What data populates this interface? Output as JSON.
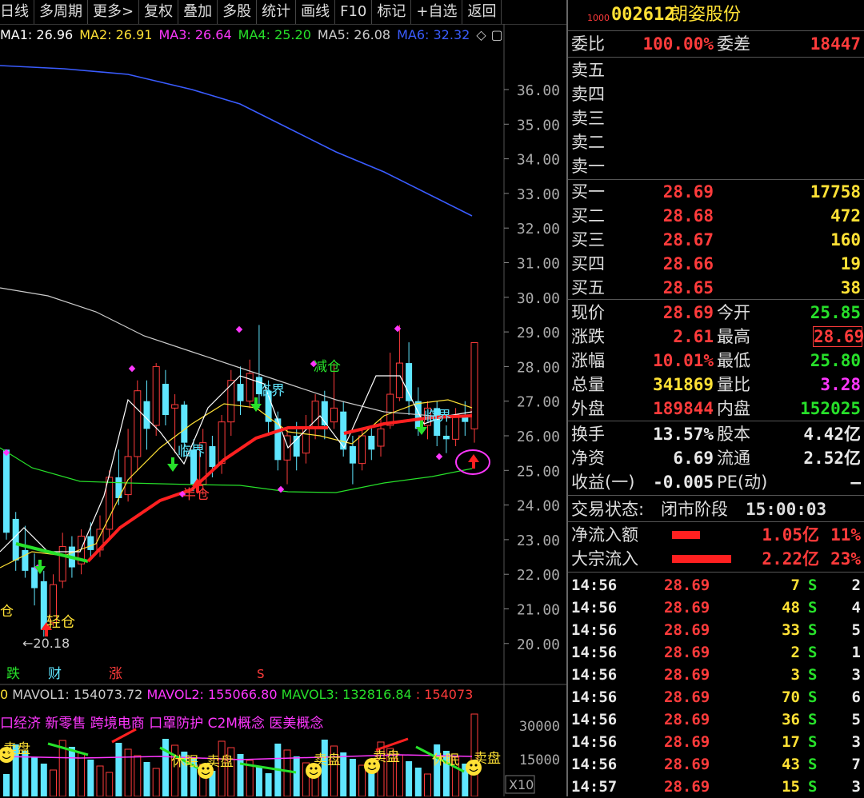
{
  "toolbar": {
    "items": [
      "日线",
      "多周期",
      "更多",
      "复权",
      "叠加",
      "多股",
      "统计",
      "画线",
      "F10",
      "标记",
      "+自选",
      "返回"
    ]
  },
  "ma_legend": [
    {
      "label": "MA1: 26.96",
      "color": "#ffffff"
    },
    {
      "label": "MA2: 26.91",
      "color": "#ffe135"
    },
    {
      "label": "MA3: 26.64",
      "color": "#ff37ff"
    },
    {
      "label": "MA4: 25.20",
      "color": "#27e02a"
    },
    {
      "label": "MA5: 26.08",
      "color": "#cccccc"
    },
    {
      "label": "MA6: 32.32",
      "color": "#3a5cff"
    }
  ],
  "price_axis": [
    "36.00",
    "35.00",
    "34.00",
    "33.00",
    "32.00",
    "31.00",
    "30.00",
    "29.00",
    "28.00",
    "27.00",
    "26.00",
    "25.00",
    "24.00",
    "23.00",
    "22.00",
    "21.00",
    "20.00"
  ],
  "chart_annotations": {
    "low_label": "←20.18",
    "light_position": "轻仓",
    "half_position": "半仓",
    "critical_1": "临界",
    "critical_2": "临界",
    "critical_3": "临界",
    "reduce_position": "减仓",
    "left_cut": "仓",
    "event_fall": "跌",
    "event_finance": "财",
    "event_rise": "涨",
    "event_s": "S"
  },
  "volume": {
    "legend_prefix": "0",
    "mavol1": "MAVOL1: 154073.72",
    "mavol2": "MAVOL2: 155066.80",
    "mavol3": "MAVOL3: 132816.84",
    "mavol4": ": 154073",
    "concepts": "口经济 新零售 跨境电商 口罩防护 C2M概念 医美概念",
    "axis": [
      "30000",
      "15000"
    ],
    "multiplier": "X10",
    "marker_labels": [
      "卖盘",
      "休眠",
      "卖盘",
      "卖盘",
      "卖盘",
      "休眠",
      "卖盘"
    ]
  },
  "stock": {
    "code_prefix": "1000",
    "code": "002612",
    "name": "朗姿股份"
  },
  "order_ratio": {
    "label": "委比",
    "value": "100.00%",
    "diff_label": "委差",
    "diff_value": "18447"
  },
  "sell": [
    "卖五",
    "卖四",
    "卖三",
    "卖二",
    "卖一"
  ],
  "buy": [
    {
      "label": "买一",
      "price": "28.69",
      "vol": "17758"
    },
    {
      "label": "买二",
      "price": "28.68",
      "vol": "472"
    },
    {
      "label": "买三",
      "price": "28.67",
      "vol": "160"
    },
    {
      "label": "买四",
      "price": "28.66",
      "vol": "19"
    },
    {
      "label": "买五",
      "price": "28.65",
      "vol": "38"
    }
  ],
  "quote": [
    {
      "l1": "现价",
      "v1": "28.69",
      "c1": "red",
      "l2": "今开",
      "v2": "25.85",
      "c2": "green"
    },
    {
      "l1": "涨跌",
      "v1": "2.61",
      "c1": "red",
      "l2": "最高",
      "v2": "28.69",
      "c2": "red"
    },
    {
      "l1": "涨幅",
      "v1": "10.01%",
      "c1": "red",
      "l2": "最低",
      "v2": "25.80",
      "c2": "green"
    },
    {
      "l1": "总量",
      "v1": "341869",
      "c1": "yellow",
      "l2": "量比",
      "v2": "3.28",
      "c2": "magenta"
    },
    {
      "l1": "外盘",
      "v1": "189844",
      "c1": "red",
      "l2": "内盘",
      "v2": "152025",
      "c2": "green"
    }
  ],
  "fundamentals": [
    {
      "l1": "换手",
      "v1": "13.57%",
      "l2": "股本",
      "v2": "4.42亿"
    },
    {
      "l1": "净资",
      "v1": "6.69",
      "l2": "流通",
      "v2": "2.52亿"
    },
    {
      "l1": "收益(一)",
      "v1": "-0.005",
      "l2": "PE(动)",
      "v2": "—"
    }
  ],
  "trade_status": {
    "label": "交易状态:",
    "status": "闭市阶段",
    "time": "15:00:03"
  },
  "flows": [
    {
      "label": "净流入额",
      "amount": "1.05亿",
      "pct": "11%",
      "bar_fraction": 0.11
    },
    {
      "label": "大宗流入",
      "amount": "2.22亿",
      "pct": "23%",
      "bar_fraction": 0.23
    }
  ],
  "ticks": [
    {
      "time": "14:56",
      "price": "28.69",
      "vol": "7",
      "side": "S",
      "n": "2"
    },
    {
      "time": "14:56",
      "price": "28.69",
      "vol": "48",
      "side": "S",
      "n": "4"
    },
    {
      "time": "14:56",
      "price": "28.69",
      "vol": "33",
      "side": "S",
      "n": "5"
    },
    {
      "time": "14:56",
      "price": "28.69",
      "vol": "2",
      "side": "S",
      "n": "1"
    },
    {
      "time": "14:56",
      "price": "28.69",
      "vol": "3",
      "side": "S",
      "n": "3"
    },
    {
      "time": "14:56",
      "price": "28.69",
      "vol": "70",
      "side": "S",
      "n": "6"
    },
    {
      "time": "14:56",
      "price": "28.69",
      "vol": "36",
      "side": "S",
      "n": "5"
    },
    {
      "time": "14:56",
      "price": "28.69",
      "vol": "17",
      "side": "S",
      "n": "3"
    },
    {
      "time": "14:56",
      "price": "28.69",
      "vol": "43",
      "side": "S",
      "n": "7"
    },
    {
      "time": "14:57",
      "price": "28.69",
      "vol": "15",
      "side": "S",
      "n": "3"
    }
  ],
  "colors": {
    "up": "#ff3b3b",
    "down": "#5fe6ff",
    "ma4": "#27e02a",
    "ma6": "#3a5cff",
    "ma5": "#cccccc"
  }
}
